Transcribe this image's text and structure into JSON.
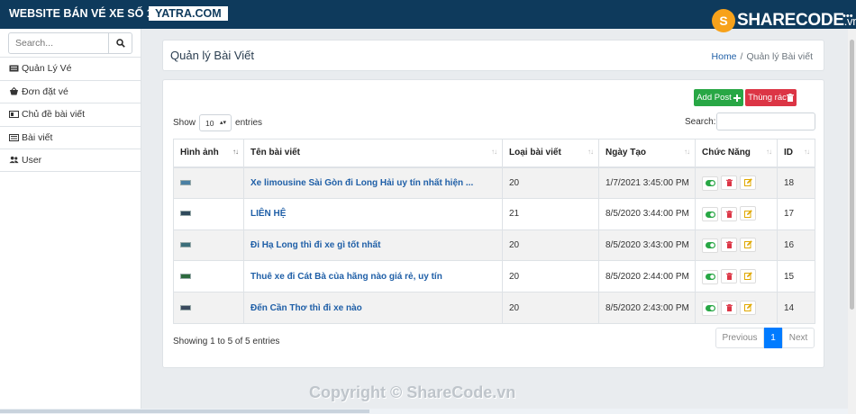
{
  "topbar": {
    "brand": "WEBSITE BÁN VÉ XE SỐ 1",
    "site": "YATRA.COM",
    "logo_text": "SHARECODE",
    "logo_suffix": ".vn",
    "logo_mark": "S"
  },
  "sidebar": {
    "search_placeholder": "Search...",
    "items": [
      {
        "label": "Quản Lý Vé",
        "icon": "ticket-icon"
      },
      {
        "label": "Đơn đặt vé",
        "icon": "basket-icon"
      },
      {
        "label": "Chủ đề bài viết",
        "icon": "topic-icon"
      },
      {
        "label": "Bài viết",
        "icon": "article-icon"
      },
      {
        "label": "User",
        "icon": "users-icon"
      }
    ]
  },
  "header": {
    "title": "Quản lý Bài Viết",
    "breadcrumb": [
      "Home",
      "Quản lý Bài viết"
    ],
    "breadcrumb_sep": "/"
  },
  "toolbar": {
    "add_label": "Add Post",
    "trash_label": "Thùng rác"
  },
  "table_controls": {
    "show": "Show",
    "entries": "entries",
    "length_value": "10",
    "search_label": "Search:"
  },
  "table": {
    "columns": [
      "Hình ảnh",
      "Tên bài viết",
      "Loại bài viết",
      "Ngày Tạo",
      "Chức Năng",
      "ID"
    ],
    "rows": [
      {
        "thumb_color": "#4a7fa3",
        "title": "Xe limousine Sài Gòn đi Long Hải uy tín nhất hiện ...",
        "type": "20",
        "date": "1/7/2021 3:45:00 PM",
        "id": "18"
      },
      {
        "thumb_color": "#2f4a5c",
        "title": "LIÊN HỆ",
        "type": "21",
        "date": "8/5/2020 3:44:00 PM",
        "id": "17"
      },
      {
        "thumb_color": "#3b6e7a",
        "title": "Đi Hạ Long thì đi xe gì tốt nhất",
        "type": "20",
        "date": "8/5/2020 3:43:00 PM",
        "id": "16"
      },
      {
        "thumb_color": "#2d6a3e",
        "title": "Thuê xe đi Cát Bà của hãng nào giá rẻ, uy tín",
        "type": "20",
        "date": "8/5/2020 2:44:00 PM",
        "id": "15"
      },
      {
        "thumb_color": "#3a4a5e",
        "title": "Đến Cần Thơ thì đi xe nào",
        "type": "20",
        "date": "8/5/2020 2:43:00 PM",
        "id": "14"
      }
    ]
  },
  "footer": {
    "info": "Showing 1 to 5 of 5 entries",
    "previous": "Previous",
    "current_page": "1",
    "next": "Next"
  },
  "watermark": "Copyright © ShareCode.vn",
  "colors": {
    "topbar": "#0e3a5c",
    "add": "#28a745",
    "trash": "#dc3545",
    "link": "#1f5fa7",
    "page_active": "#007bff"
  }
}
